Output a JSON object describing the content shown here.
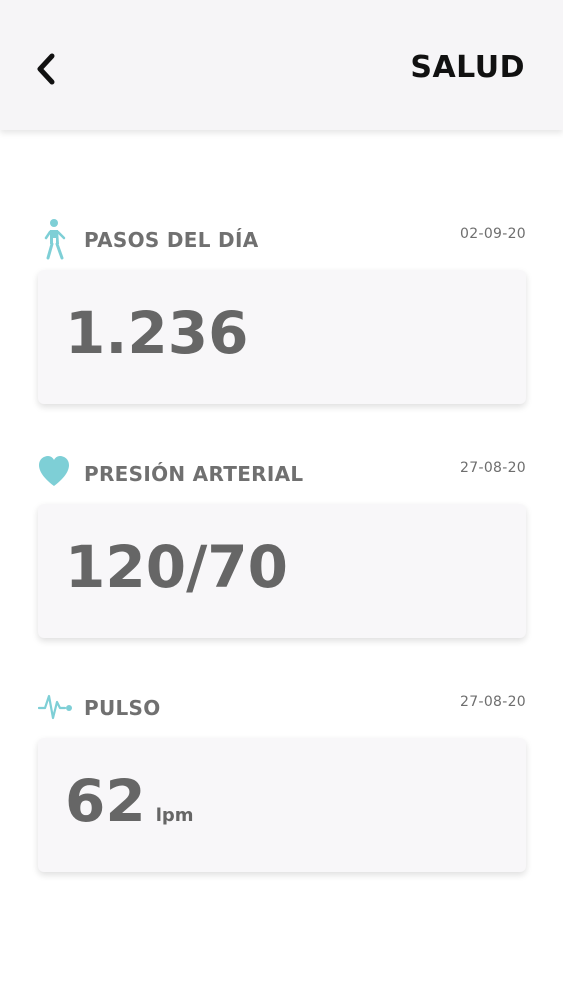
{
  "header": {
    "title": "SALUD",
    "back_icon": "chevron-left-icon"
  },
  "sections": [
    {
      "label": "PASOS DEL DÍA",
      "date": "02-09-20",
      "value": "1.236",
      "unit": "",
      "icon": "walking-person-icon",
      "icon_color": "#7ecfd6"
    },
    {
      "label": "PRESIÓN ARTERIAL",
      "date": "27-08-20",
      "value": "120/70",
      "unit": "",
      "icon": "heart-icon",
      "icon_color": "#7ecfd6"
    },
    {
      "label": "PULSO",
      "date": "27-08-20",
      "value": "62",
      "unit": "lpm",
      "icon": "pulse-icon",
      "icon_color": "#7ecfd6"
    }
  ],
  "colors": {
    "accent": "#7ecfd6",
    "header_bg": "#f6f5f7",
    "card_bg": "#f8f7f9",
    "text_gray": "#666666"
  }
}
